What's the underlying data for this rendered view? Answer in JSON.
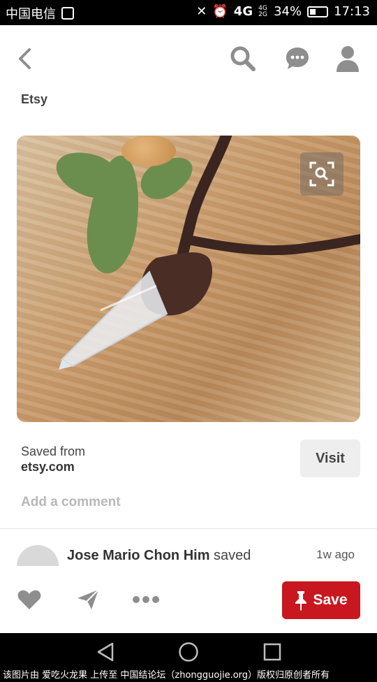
{
  "status_bar": {
    "carrier": "中国电信",
    "network": "4G",
    "network_small": "4G 2G",
    "battery": "34%",
    "time": "17:13"
  },
  "header": {
    "back_icon": "chevron-left-icon",
    "search_icon": "search-icon",
    "messages_icon": "chat-bubble-icon",
    "profile_icon": "user-icon"
  },
  "pin": {
    "source_label": "Etsy",
    "saved_from_label": "Saved from",
    "saved_from_domain": "etsy.com",
    "visit_label": "Visit",
    "add_comment_label": "Add a comment"
  },
  "activity": {
    "user_name": "Jose Mario Chon Him",
    "verb": "saved",
    "time_ago": "1w ago"
  },
  "actions": {
    "save_label": "Save"
  },
  "footer": {
    "text": "该图片由 爱吃火龙果 上传至 中国结论坛（zhongguojie.org）版权归原创者所有"
  },
  "colors": {
    "save_red": "#c8171e",
    "icon_gray": "#8e8e8e"
  }
}
